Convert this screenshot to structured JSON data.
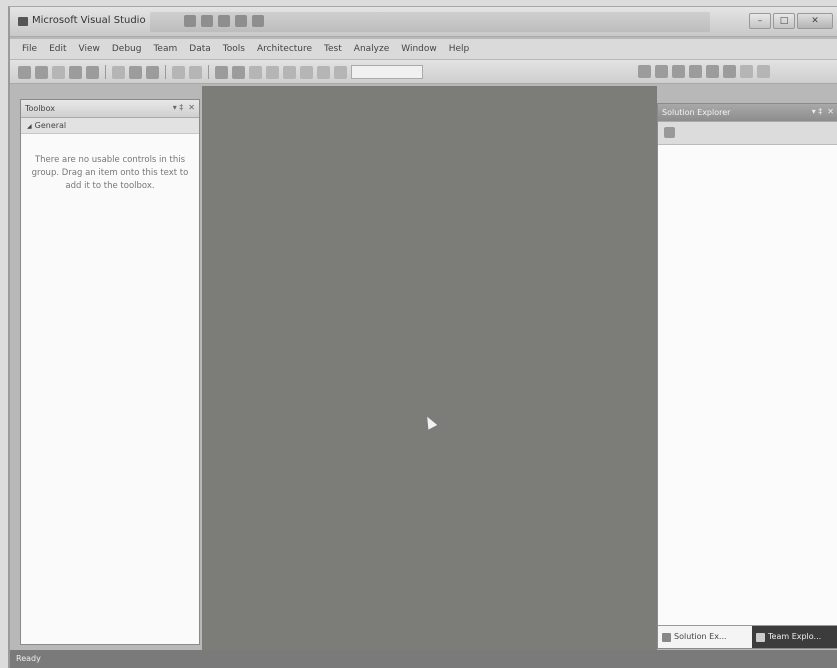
{
  "window": {
    "title": "Microsoft Visual Studio",
    "controls": {
      "minimize": "–",
      "maximize": "□",
      "close": "✕"
    }
  },
  "menu": {
    "items": [
      "File",
      "Edit",
      "View",
      "Debug",
      "Team",
      "Data",
      "Tools",
      "Architecture",
      "Test",
      "Analyze",
      "Window",
      "Help"
    ]
  },
  "toolbox": {
    "title": "Toolbox",
    "controls": {
      "pin": "▾ ‡",
      "close": "✕"
    },
    "group": "General",
    "empty_message": "There are no usable controls in this group. Drag an item onto this text to add it to the toolbox."
  },
  "solution_explorer": {
    "title": "Solution Explorer",
    "controls": {
      "pin": "▾ ‡",
      "close": "✕"
    },
    "tabs": [
      "Solution Ex...",
      "Team Explo..."
    ]
  },
  "status": {
    "text": "Ready"
  },
  "icons": {
    "toolbox_group": "collapse-triangle-icon",
    "solution_tab": "solution-icon",
    "team_tab": "team-explorer-icon"
  },
  "colors": {
    "editor_background": "#7c7c78",
    "status_bar": "#7a7a7a"
  }
}
